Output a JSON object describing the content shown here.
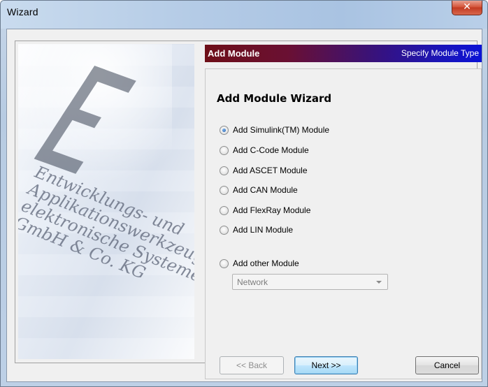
{
  "window": {
    "title": "Wizard"
  },
  "header": {
    "title": "Add Module",
    "subtitle": "Specify Module Type"
  },
  "logo_text": [
    "Entwicklungs- und",
    "Applikationswerkzeuge für",
    "elektronische Systeme",
    "GmbH & Co. KG"
  ],
  "wizard": {
    "heading": "Add Module Wizard",
    "options": [
      {
        "label": "Add Simulink(TM) Module",
        "checked": true
      },
      {
        "label": "Add C-Code Module",
        "checked": false
      },
      {
        "label": "Add ASCET Module",
        "checked": false
      },
      {
        "label": "Add CAN Module",
        "checked": false
      },
      {
        "label": "Add FlexRay Module",
        "checked": false
      },
      {
        "label": "Add LIN Module",
        "checked": false
      }
    ],
    "other_option": {
      "label": "Add other Module",
      "checked": false
    },
    "other_select": {
      "value": "Network"
    }
  },
  "buttons": {
    "back": "<< Back",
    "next": "Next >>",
    "cancel": "Cancel"
  },
  "colors": {
    "header_start": "#6e0f18",
    "header_end": "#0b12d6",
    "close": "#c23b22"
  }
}
